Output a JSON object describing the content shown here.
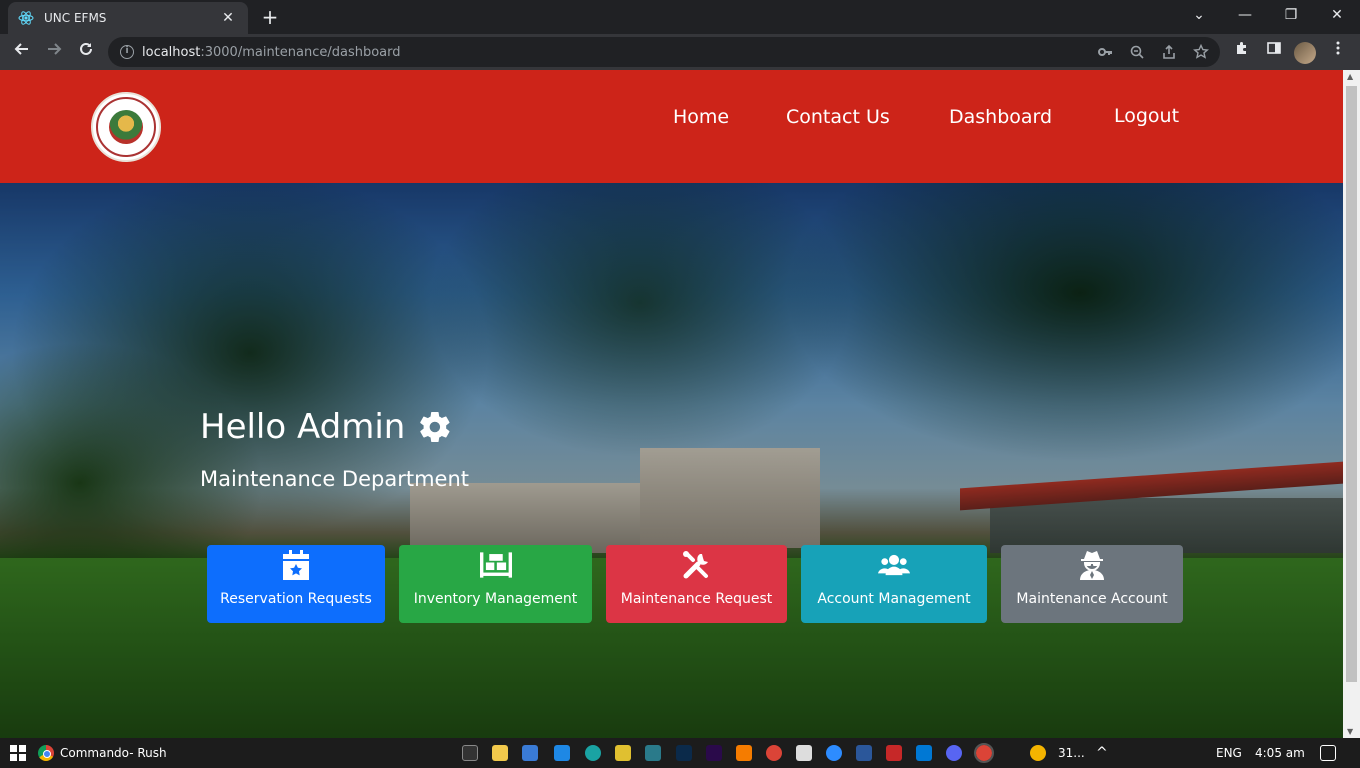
{
  "browser": {
    "tab_title": "UNC EFMS",
    "tab_close": "✕",
    "new_tab": "+",
    "url_host": "localhost",
    "url_path": ":3000/maintenance/dashboard",
    "window_controls": {
      "chevron": "⌄",
      "minimize": "—",
      "restore": "❐",
      "close": "✕"
    }
  },
  "site": {
    "nav": [
      "Home",
      "Contact Us",
      "Dashboard",
      "Logout"
    ]
  },
  "hero": {
    "greeting": "Hello Admin",
    "department": "Maintenance Department"
  },
  "tiles": [
    {
      "label": "Reservation Requests",
      "color": "#0d6efd",
      "icon": "calendar-star-icon"
    },
    {
      "label": "Inventory Management",
      "color": "#28a745",
      "icon": "pallet-icon"
    },
    {
      "label": "Maintenance Request",
      "color": "#dc3545",
      "icon": "tools-icon"
    },
    {
      "label": "Account Management",
      "color": "#17a2b8",
      "icon": "users-icon"
    },
    {
      "label": "Maintenance Account",
      "color": "#6c757d",
      "icon": "user-secret-icon"
    }
  ],
  "colors": {
    "header": "#cd2419"
  },
  "taskbar": {
    "active_app": "Commando- Rush",
    "weather": "31...",
    "language": "ENG",
    "time": "4:05 am"
  }
}
